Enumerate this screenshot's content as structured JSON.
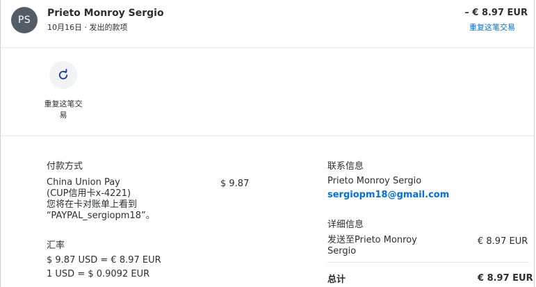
{
  "header": {
    "avatar_initials": "PS",
    "name": "Prieto Monroy Sergio",
    "date_type": "10月16日 · 发出的款项",
    "amount": "– € 8.97 EUR",
    "repeat_link": "重复这笔交易"
  },
  "actions": {
    "repeat_label": "重复这笔交易"
  },
  "payment": {
    "title": "付款方式",
    "lines": [
      "China Union Pay",
      "(CUP信用卡x-4221)",
      "您将在卡对账单上看到",
      "“PAYPAL_sergiopm18”。"
    ],
    "amount": "$ 9.87"
  },
  "exchange": {
    "title": "汇率",
    "line1": "$ 9.87 USD = € 8.97 EUR",
    "line2": "1 USD = $ 0.9092 EUR"
  },
  "contact": {
    "title": "联系信息",
    "name": "Prieto Monroy Sergio",
    "email": "sergiopm18@gmail.com"
  },
  "details": {
    "title": "详细信息",
    "lines": [
      "发送至Prieto Monroy",
      "Sergio"
    ],
    "amount": "€ 8.97 EUR",
    "total_label": "总计",
    "total_amount": "€ 8.97 EUR"
  },
  "colors": {
    "link": "#0070e0",
    "avatar_bg": "#545c66",
    "text": "#2c2e2f"
  },
  "icons": {
    "repeat": "refresh-icon"
  }
}
